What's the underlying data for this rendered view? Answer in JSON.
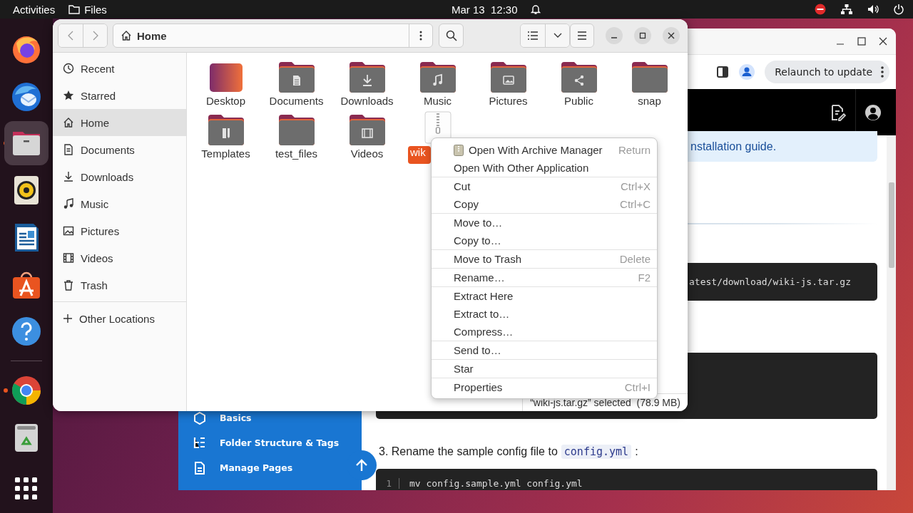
{
  "top_bar": {
    "activities": "Activities",
    "app_name": "Files",
    "clock": "Mar 13  12:30"
  },
  "dock": {
    "favorites": [
      {
        "kind": "firefox",
        "running": false,
        "selected": false
      },
      {
        "kind": "thunderbird",
        "running": false,
        "selected": false
      },
      {
        "kind": "files",
        "running": true,
        "selected": true
      },
      {
        "kind": "rhythmbox",
        "running": false,
        "selected": false
      },
      {
        "kind": "writer",
        "running": false,
        "selected": false
      },
      {
        "kind": "appcenter",
        "running": false,
        "selected": false
      },
      {
        "kind": "help",
        "running": false,
        "selected": false
      }
    ],
    "others": [
      {
        "kind": "chrome",
        "running": true,
        "selected": false
      },
      {
        "kind": "trash",
        "running": false,
        "selected": false
      }
    ]
  },
  "browser": {
    "relaunch": "Relaunch to update",
    "nav": [
      {
        "label": "Basics",
        "kind": "cube"
      },
      {
        "label": "Folder Structure & Tags",
        "kind": "tree"
      },
      {
        "label": "Manage Pages",
        "kind": "page"
      }
    ],
    "banner": "nstallation guide.",
    "command": "atest/download/wiki-js.tar.gz",
    "step": {
      "text": "3. Rename the sample config file to",
      "code": "config.yml",
      "end": ":"
    },
    "code_lines": [
      {
        "number": "1",
        "code": "mv config.sample.yml config.yml"
      }
    ]
  },
  "files": {
    "path": "Home",
    "sidebar": [
      {
        "label": "Recent",
        "kind": "recent",
        "selected": false
      },
      {
        "label": "Starred",
        "kind": "starred",
        "selected": false
      },
      {
        "label": "Home",
        "kind": "home",
        "selected": true
      },
      {
        "label": "Documents",
        "kind": "documents",
        "selected": false
      },
      {
        "label": "Downloads",
        "kind": "downloads",
        "selected": false
      },
      {
        "label": "Music",
        "kind": "music",
        "selected": false
      },
      {
        "label": "Pictures",
        "kind": "pictures",
        "selected": false
      },
      {
        "label": "Videos",
        "kind": "videos",
        "selected": false
      },
      {
        "label": "Trash",
        "kind": "trash",
        "selected": false
      }
    ],
    "other_locations": "Other Locations",
    "items": [
      {
        "name": "Desktop",
        "kind": "desktop",
        "selected": false
      },
      {
        "name": "Documents",
        "kind": "documents",
        "selected": false
      },
      {
        "name": "Downloads",
        "kind": "downloads",
        "selected": false
      },
      {
        "name": "Music",
        "kind": "music",
        "selected": false
      },
      {
        "name": "Pictures",
        "kind": "pictures",
        "selected": false
      },
      {
        "name": "Public",
        "kind": "public",
        "selected": false
      },
      {
        "name": "snap",
        "kind": "folder",
        "selected": false
      },
      {
        "name": "Templates",
        "kind": "templates",
        "selected": false
      },
      {
        "name": "test_files",
        "kind": "folder",
        "selected": false
      },
      {
        "name": "Videos",
        "kind": "videos",
        "selected": false
      },
      {
        "name": "wik",
        "kind": "archive",
        "selected": true
      }
    ],
    "status": "“wiki-js.tar.gz” selected  (78.9 MB)"
  },
  "context_menu": {
    "groups": [
      [
        {
          "label": "Open With Archive Manager",
          "shortcut": "Return",
          "kind": "app"
        },
        {
          "label": "Open With Other Application"
        }
      ],
      [
        {
          "label": "Cut",
          "shortcut": "Ctrl+X"
        },
        {
          "label": "Copy",
          "shortcut": "Ctrl+C"
        }
      ],
      [
        {
          "label": "Move to…"
        },
        {
          "label": "Copy to…"
        }
      ],
      [
        {
          "label": "Move to Trash",
          "shortcut": "Delete"
        }
      ],
      [
        {
          "label": "Rename…",
          "shortcut": "F2"
        }
      ],
      [
        {
          "label": "Extract Here"
        },
        {
          "label": "Extract to…"
        },
        {
          "label": "Compress…"
        }
      ],
      [
        {
          "label": "Send to…"
        }
      ],
      [
        {
          "label": "Star"
        }
      ],
      [
        {
          "label": "Properties",
          "shortcut": "Ctrl+I"
        }
      ]
    ]
  }
}
